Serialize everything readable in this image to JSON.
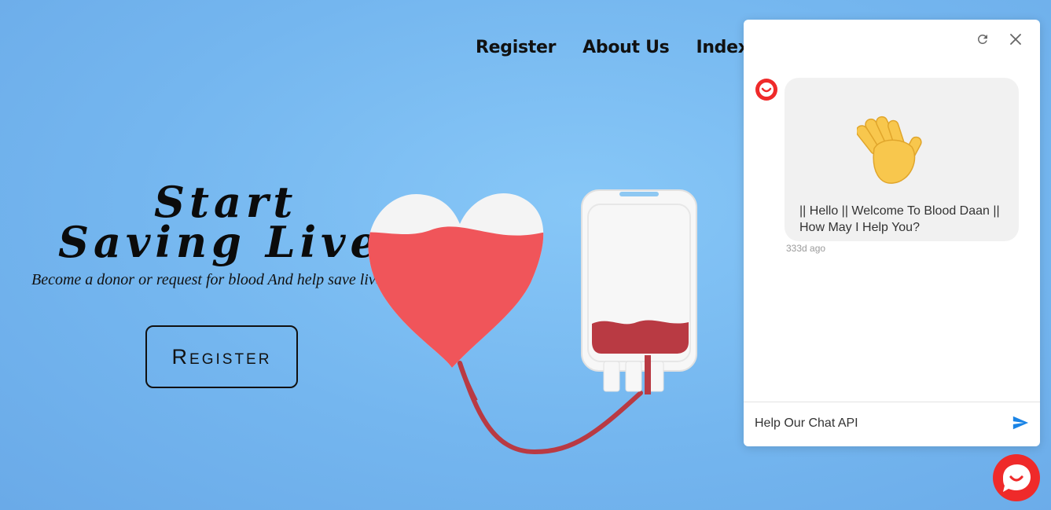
{
  "nav": {
    "items": [
      "Register",
      "About Us",
      "Index"
    ]
  },
  "hero": {
    "title_line1": "Start",
    "title_line2": "Saving Lives",
    "tagline": "Become a donor or request for blood  And help save lives",
    "button_label": "Register"
  },
  "chat": {
    "message": "|| Hello || Welcome To Blood Daan || How May I Help You?",
    "timestamp": "333d ago",
    "input_value": "Help Our Chat API",
    "icons": [
      "refresh-icon",
      "close-icon",
      "send-icon",
      "chat-bot-logo-icon",
      "wave-emoji-icon"
    ]
  },
  "colors": {
    "background": "#74b6ef",
    "brand_red": "#ef2a2a",
    "send_blue": "#1a84e6",
    "heart_red": "#f0555a",
    "blood_dark": "#b93a43"
  }
}
